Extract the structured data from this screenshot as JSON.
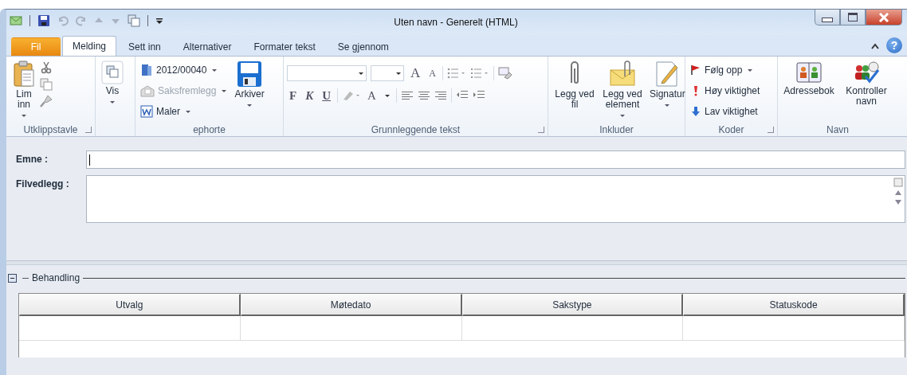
{
  "window": {
    "title": "Uten navn  -  Generelt (HTML)",
    "help": "?"
  },
  "tabs": [
    {
      "label": "Fil",
      "kind": "file",
      "selected": false
    },
    {
      "label": "Melding",
      "kind": "tab",
      "selected": true
    },
    {
      "label": "Sett inn",
      "kind": "tab",
      "selected": false
    },
    {
      "label": "Alternativer",
      "kind": "tab",
      "selected": false
    },
    {
      "label": "Formater tekst",
      "kind": "tab",
      "selected": false
    },
    {
      "label": "Se gjennom",
      "kind": "tab",
      "selected": false
    }
  ],
  "ribbon": {
    "groups": [
      {
        "label": "Utklippstavle",
        "launcher": true,
        "large": [
          {
            "label": "Lim inn",
            "dropdown": true
          }
        ]
      },
      {
        "large": [
          {
            "label": "Vis",
            "dropdown": true
          }
        ]
      },
      {
        "label": "ephorte",
        "launcher": false,
        "small": [
          {
            "label": "2012/00040",
            "dropdown": true,
            "disabled": false
          },
          {
            "label": "Saksfremlegg",
            "dropdown": true,
            "disabled": true
          },
          {
            "label": "Maler",
            "dropdown": true,
            "disabled": false
          }
        ],
        "large": [
          {
            "label": "Arkiver",
            "dropdown": true
          }
        ]
      },
      {
        "label": "Grunnleggende tekst",
        "launcher": true,
        "size_buttons": [
          "A",
          "A"
        ],
        "format_buttons": [
          "F",
          "K",
          "U"
        ],
        "color_button": "A"
      },
      {
        "label": "Inkluder",
        "launcher": false,
        "large": [
          {
            "label": "Legg ved fil",
            "dropdown": false
          },
          {
            "label": "Legg ved element",
            "dropdown": true
          },
          {
            "label": "Signatur",
            "dropdown": true
          }
        ]
      },
      {
        "label": "Koder",
        "launcher": true,
        "small": [
          {
            "label": "Følg opp",
            "dropdown": true,
            "disabled": false
          },
          {
            "label": "Høy viktighet",
            "dropdown": false,
            "disabled": false
          },
          {
            "label": "Lav viktighet",
            "dropdown": false,
            "disabled": false
          }
        ]
      },
      {
        "label": "Navn",
        "launcher": false,
        "large": [
          {
            "label": "Adressebok",
            "dropdown": false
          },
          {
            "label": "Kontroller navn",
            "dropdown": false
          }
        ]
      }
    ]
  },
  "fields": [
    {
      "label": "Emne :",
      "kind": "line",
      "focused": true
    },
    {
      "label": "Filvedlegg :",
      "kind": "box",
      "focused": false
    }
  ],
  "section": {
    "title": "Behandling",
    "expanded": true,
    "columns": [
      "Utvalg",
      "Møtedato",
      "Sakstype",
      "Statuskode"
    ]
  }
}
